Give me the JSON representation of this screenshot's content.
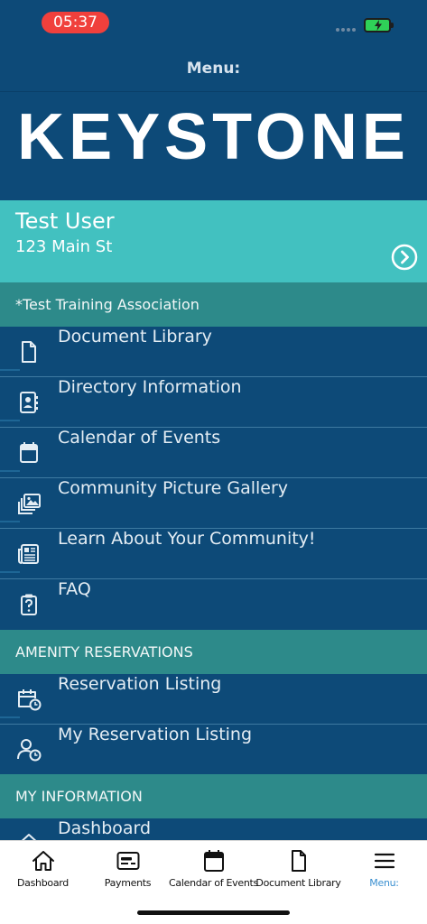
{
  "status_bar": {
    "time": "05:37",
    "battery_color": "#2fd158",
    "time_pill_color": "#f0403c"
  },
  "header": {
    "title": "Menu:",
    "logo_text": "KEYSTONE"
  },
  "user_card": {
    "name": "Test User",
    "address": "123 Main St",
    "chevron_icon": "chevron-right-circle-icon"
  },
  "sections": [
    {
      "title": "*Test Training Association",
      "items": [
        {
          "label": "Document Library",
          "icon": "document-icon"
        },
        {
          "label": "Directory Information",
          "icon": "contact-card-icon"
        },
        {
          "label": "Calendar of Events",
          "icon": "calendar-icon"
        },
        {
          "label": "Community Picture Gallery",
          "icon": "photo-gallery-icon"
        },
        {
          "label": "Learn About Your Community!",
          "icon": "newspaper-icon"
        },
        {
          "label": "FAQ",
          "icon": "question-clipboard-icon"
        }
      ]
    },
    {
      "title": "AMENITY RESERVATIONS",
      "items": [
        {
          "label": "Reservation Listing",
          "icon": "calendar-clock-icon"
        },
        {
          "label": "My Reservation Listing",
          "icon": "user-clock-icon"
        }
      ]
    },
    {
      "title": "MY INFORMATION",
      "items": [
        {
          "label": "Dashboard",
          "icon": "home-icon"
        }
      ]
    }
  ],
  "tab_bar": {
    "tabs": [
      {
        "label": "Dashboard",
        "icon": "home-icon",
        "active": false
      },
      {
        "label": "Payments",
        "icon": "payment-card-icon",
        "active": false
      },
      {
        "label": "Calendar of Events",
        "icon": "calendar-icon",
        "active": false
      },
      {
        "label": "Document Library",
        "icon": "document-icon",
        "active": false
      },
      {
        "label": "Menu:",
        "icon": "hamburger-menu-icon",
        "active": true
      }
    ],
    "active_color": "#3a8fd0"
  },
  "colors": {
    "primary_navy": "#0d4a78",
    "teal_card": "#42c1c0",
    "section_teal": "#2d8a8a"
  }
}
